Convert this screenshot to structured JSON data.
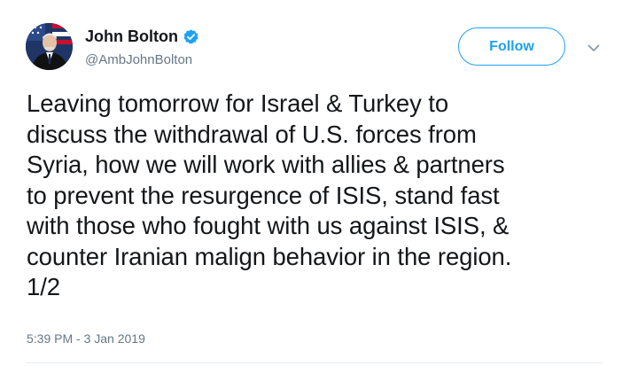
{
  "author": {
    "display_name": "John Bolton",
    "handle": "@AmbJohnBolton",
    "verified": true
  },
  "actions": {
    "follow_label": "Follow",
    "menu_icon": "chevron-down-icon"
  },
  "tweet": {
    "lines": [
      "Leaving tomorrow for Israel & Turkey to",
      "discuss the withdrawal of U.S. forces from",
      "Syria, how we will work with allies & partners",
      "to prevent the resurgence of ISIS, stand fast",
      "with those who fought with us against ISIS, &",
      "counter Iranian malign behavior in the region.",
      "1/2"
    ],
    "timestamp": "5:39 PM - 3 Jan 2019"
  },
  "colors": {
    "accent": "#1da1f2",
    "text": "#14171a",
    "secondary_text": "#657786",
    "divider": "#e6ecf0"
  }
}
